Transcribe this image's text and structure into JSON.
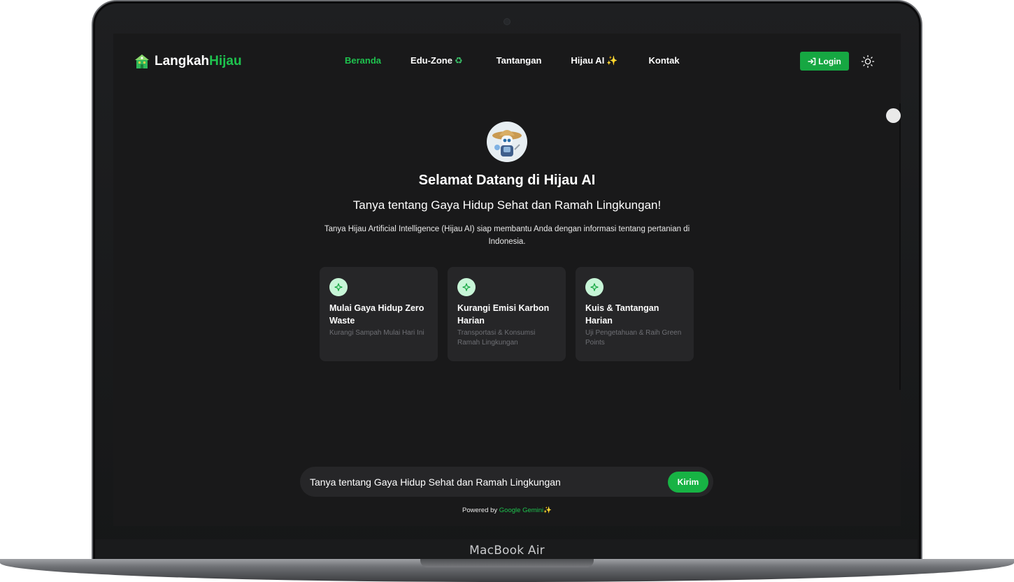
{
  "device": {
    "label": "MacBook Air"
  },
  "brand": {
    "name_part1": "Langkah",
    "name_part2": "Hijau",
    "logo_icon": "green-building-icon"
  },
  "nav": {
    "items": [
      {
        "label": "Beranda",
        "active": true
      },
      {
        "label": "Edu-Zone",
        "emoji": "♻"
      },
      {
        "label": "Tantangan"
      },
      {
        "label": "Hijau AI",
        "emoji": "✨"
      },
      {
        "label": "Kontak"
      }
    ],
    "login_label": "Login",
    "login_icon": "login-arrow-icon",
    "theme_icon": "sun-icon"
  },
  "hero": {
    "avatar_icon": "farmer-robot-avatar",
    "title": "Selamat Datang di Hijau AI",
    "subtitle": "Tanya tentang Gaya Hidup Sehat dan Ramah Lingkungan!",
    "description": "Tanya Hijau Artificial Intelligence (Hijau AI) siap membantu Anda dengan informasi tentang pertanian di Indonesia."
  },
  "cards": [
    {
      "title": "Mulai Gaya Hidup Zero Waste",
      "description": "Kurangi Sampah Mulai Hari Ini",
      "icon": "sparkle-icon"
    },
    {
      "title": "Kurangi Emisi Karbon Harian",
      "description": "Transportasi & Konsumsi Ramah Lingkungan",
      "icon": "sparkle-icon"
    },
    {
      "title": "Kuis & Tantangan Harian",
      "description": "Uji Pengetahuan & Raih Green Points",
      "icon": "sparkle-icon"
    }
  ],
  "chat": {
    "placeholder": "Tanya tentang Gaya Hidup Sehat dan Ramah Lingkungan",
    "send_label": "Kirim"
  },
  "footer": {
    "powered_prefix": "Powered by",
    "powered_link": "Google Gemini",
    "powered_emoji": "✨"
  },
  "colors": {
    "accent": "#1ec24e",
    "button": "#16a742",
    "background": "#19191a",
    "card": "#262628"
  }
}
